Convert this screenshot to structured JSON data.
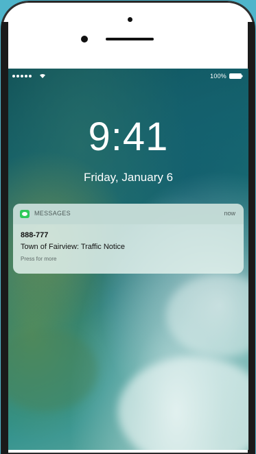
{
  "status_bar": {
    "battery_percent": "100%",
    "signal_bars": 5
  },
  "lock_screen": {
    "time": "9:41",
    "date": "Friday, January 6"
  },
  "notification": {
    "app_name": "MESSAGES",
    "timestamp": "now",
    "sender": "888-777",
    "message": "Town of Fairview: Traffic Notice",
    "hint": "Press for more",
    "app_icon": "messages-icon",
    "app_icon_color": "#2ec95a"
  },
  "colors": {
    "background": "#4fb5cb",
    "wallpaper_dark": "#0e4e55",
    "wallpaper_light": "#6aaea6"
  }
}
